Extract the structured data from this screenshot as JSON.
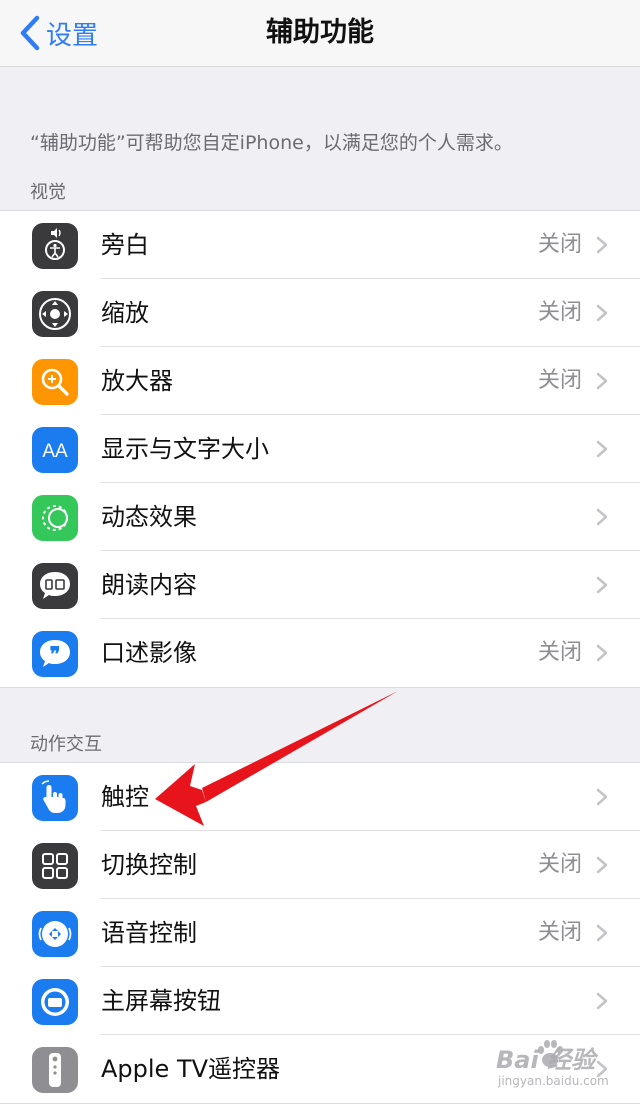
{
  "nav": {
    "back_label": "设置",
    "title": "辅助功能"
  },
  "description": "“辅助功能”可帮助您自定iPhone，以满足您的个人需求。",
  "sections": {
    "vision": {
      "header": "视觉",
      "items": [
        {
          "label": "旁白",
          "value": "关闭",
          "icon": "voiceover-icon",
          "icon_bg": "#3a3a3c"
        },
        {
          "label": "缩放",
          "value": "关闭",
          "icon": "zoom-icon",
          "icon_bg": "#3a3a3c"
        },
        {
          "label": "放大器",
          "value": "关闭",
          "icon": "magnifier-icon",
          "icon_bg": "#ff9500"
        },
        {
          "label": "显示与文字大小",
          "value": "",
          "icon": "display-text-size-icon",
          "icon_bg": "#1b7cf0"
        },
        {
          "label": "动态效果",
          "value": "",
          "icon": "motion-icon",
          "icon_bg": "#34c759"
        },
        {
          "label": "朗读内容",
          "value": "",
          "icon": "spoken-content-icon",
          "icon_bg": "#3a3a3c"
        },
        {
          "label": "口述影像",
          "value": "关闭",
          "icon": "audio-description-icon",
          "icon_bg": "#1b7cf0"
        }
      ]
    },
    "interaction": {
      "header": "动作交互",
      "items": [
        {
          "label": "触控",
          "value": "",
          "icon": "touch-icon",
          "icon_bg": "#1b7cf0"
        },
        {
          "label": "切换控制",
          "value": "关闭",
          "icon": "switch-control-icon",
          "icon_bg": "#3a3a3c"
        },
        {
          "label": "语音控制",
          "value": "关闭",
          "icon": "voice-control-icon",
          "icon_bg": "#1b7cf0"
        },
        {
          "label": "主屏幕按钮",
          "value": "",
          "icon": "home-button-icon",
          "icon_bg": "#1b7cf0"
        },
        {
          "label": "Apple TV遥控器",
          "value": "",
          "icon": "apple-tv-remote-icon",
          "icon_bg": "#8e8e93"
        }
      ]
    }
  },
  "watermark": {
    "main": "Bai 经验",
    "sub": "jingyan.baidu.com"
  },
  "colors": {
    "accent": "#2f7cf6",
    "annotation_arrow": "#e8141c"
  }
}
